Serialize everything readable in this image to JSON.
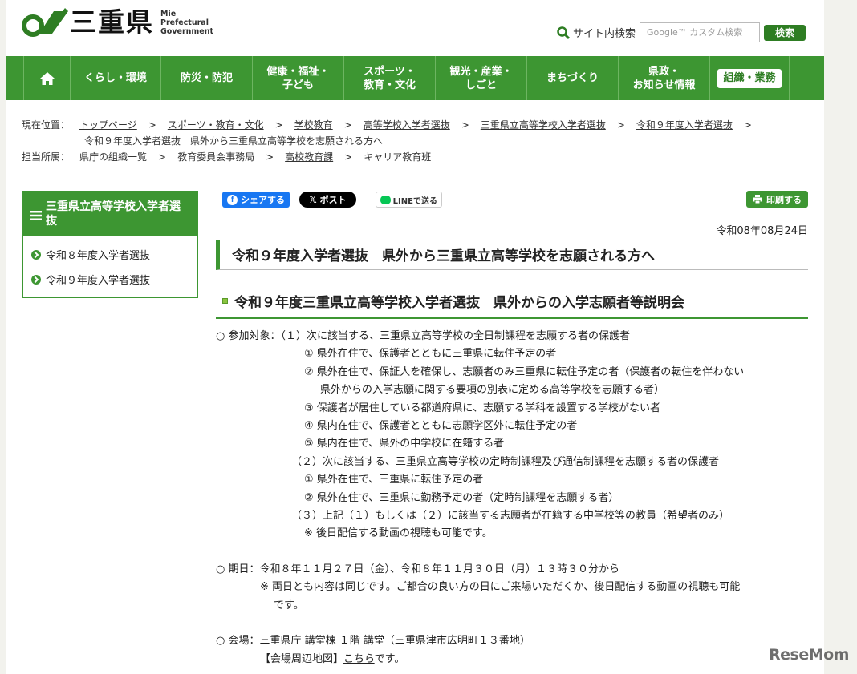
{
  "header": {
    "logo_kanji": "三重県",
    "logo_en_1": "Mie",
    "logo_en_2": "Prefectural",
    "logo_en_3": "Government",
    "search_label": "サイト内検索",
    "search_placeholder": "Google™ カスタム検索",
    "search_button": "検索"
  },
  "nav": {
    "items": [
      {
        "line1": "くらし・環境",
        "line2": ""
      },
      {
        "line1": "防災・防犯",
        "line2": ""
      },
      {
        "line1": "健康・福祉・",
        "line2": "子ども"
      },
      {
        "line1": "スポーツ・",
        "line2": "教育・文化"
      },
      {
        "line1": "観光・産業・",
        "line2": "しごと"
      },
      {
        "line1": "まちづくり",
        "line2": ""
      },
      {
        "line1": "県政・",
        "line2": "お知らせ情報"
      }
    ],
    "org": "組織・業務"
  },
  "breadcrumb": {
    "location_label": "現在位置：",
    "items": [
      "トップページ",
      "スポーツ・教育・文化",
      "学校教育",
      "高等学校入学者選抜",
      "三重県立高等学校入学者選抜",
      "令和９年度入学者選抜"
    ],
    "current": "令和９年度入学者選抜　県外から三重県立高等学校を志願される方へ",
    "dept_label": "担当所属：",
    "dept_items": [
      "県庁の組織一覧",
      "教育委員会事務局",
      "高校教育課",
      "キャリア教育班"
    ]
  },
  "sidebar": {
    "title": "三重県立高等学校入学者選抜",
    "items": [
      "令和８年度入学者選抜",
      "令和９年度入学者選抜"
    ]
  },
  "social": {
    "facebook": "シェアする",
    "x": "ポスト",
    "line": "LINEで送る",
    "print": "印刷する"
  },
  "main": {
    "date": "令和08年08月24日",
    "title": "令和９年度入学者選抜　県外から三重県立高等学校を志願される方へ",
    "subtitle": "令和９年度三重県立高等学校入学者選抜　県外からの入学志願者等説明会",
    "lines": {
      "t1": "○ 参加対象：（１）次に該当する、三重県立高等学校の全日制課程を志願する者の保護者",
      "t1_1": "① 県外在住で、保護者とともに三重県に転住予定の者",
      "t1_2a": "② 県外在住で、保証人を確保し、志願者のみ三重県に転住予定の者（保護者の転住を伴わない",
      "t1_2b": "県外からの入学志願に関する要項の別表に定める高等学校を志願する者）",
      "t1_3": "③ 保護者が居住している都道府県に、志願する学科を設置する学校がない者",
      "t1_4": "④ 県内在住で、保護者とともに志願学区外に転住予定の者",
      "t1_5": "⑤ 県内在住で、県外の中学校に在籍する者",
      "t2": "（２）次に該当する、三重県立高等学校の定時制課程及び通信制課程を志願する者の保護者",
      "t2_1": "① 県外在住で、三重県に転住予定の者",
      "t2_2": "② 県外在住で、三重県に勤務予定の者（定時制課程を志願する者）",
      "t3": "（３）上記（１）もしくは（２）に該当する志願者が在籍する中学校等の教員（希望者のみ）",
      "t3_note": "※ 後日配信する動画の視聴も可能です。",
      "period": "○ 期日：令和８年１１月２７日（金）、令和８年１１月３０日（月）１３時３０分から",
      "period_note_a": "※ 両日とも内容は同じです。ご都合の良い方の日にご来場いただくか、後日配信する動画の視聴も可能",
      "period_note_b": "です。",
      "venue": "○ 会場：三重県庁 講堂棟 １階 講堂（三重県津市広明町１３番地）",
      "map_prefix": "【会場周辺地図】",
      "map_link": "こちら",
      "map_suffix": "です。"
    }
  },
  "watermark": "ReseMom"
}
